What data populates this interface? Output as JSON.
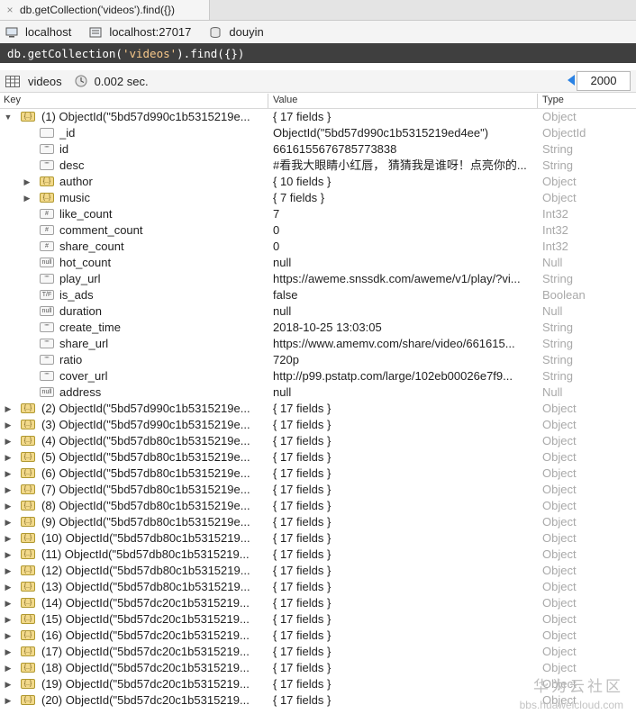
{
  "tab": {
    "title": "db.getCollection('videos').find({})",
    "close_glyph": "×"
  },
  "connection": {
    "host": "localhost",
    "port_label": "localhost:27017",
    "database": "douyin"
  },
  "query": {
    "prefix": "db.getCollection(",
    "collection_literal": "'videos'",
    "suffix": ").find({})"
  },
  "result": {
    "collection": "videos",
    "time": "0.002 sec.",
    "page_size": "2000"
  },
  "columns": {
    "key": "Key",
    "value": "Value",
    "type": "Type"
  },
  "rows": [
    {
      "key": "(1) ObjectId(\"5bd57d990c1b5315219e...",
      "value": "{ 17 fields }",
      "type": "Object",
      "level": 0,
      "tri": "▼",
      "icon": "obj"
    },
    {
      "key": "_id",
      "value": "ObjectId(\"5bd57d990c1b5315219ed4ee\")",
      "type": "ObjectId",
      "level": 1,
      "tri": "",
      "icon": "id"
    },
    {
      "key": "id",
      "value": "6616155676785773838",
      "type": "String",
      "level": 1,
      "tri": "",
      "icon": "str"
    },
    {
      "key": "desc",
      "value": "#看我大眼睛小红唇， 猜猜我是谁呀！点亮你的...",
      "type": "String",
      "level": 1,
      "tri": "",
      "icon": "str"
    },
    {
      "key": "author",
      "value": "{ 10 fields }",
      "type": "Object",
      "level": 1,
      "tri": "▶",
      "icon": "obj"
    },
    {
      "key": "music",
      "value": "{ 7 fields }",
      "type": "Object",
      "level": 1,
      "tri": "▶",
      "icon": "obj"
    },
    {
      "key": "like_count",
      "value": "7",
      "type": "Int32",
      "level": 1,
      "tri": "",
      "icon": "num"
    },
    {
      "key": "comment_count",
      "value": "0",
      "type": "Int32",
      "level": 1,
      "tri": "",
      "icon": "num"
    },
    {
      "key": "share_count",
      "value": "0",
      "type": "Int32",
      "level": 1,
      "tri": "",
      "icon": "num"
    },
    {
      "key": "hot_count",
      "value": "null",
      "type": "Null",
      "level": 1,
      "tri": "",
      "icon": "null"
    },
    {
      "key": "play_url",
      "value": "https://aweme.snssdk.com/aweme/v1/play/?vi...",
      "type": "String",
      "level": 1,
      "tri": "",
      "icon": "str"
    },
    {
      "key": "is_ads",
      "value": "false",
      "type": "Boolean",
      "level": 1,
      "tri": "",
      "icon": "bool"
    },
    {
      "key": "duration",
      "value": "null",
      "type": "Null",
      "level": 1,
      "tri": "",
      "icon": "null"
    },
    {
      "key": "create_time",
      "value": "2018-10-25 13:03:05",
      "type": "String",
      "level": 1,
      "tri": "",
      "icon": "str"
    },
    {
      "key": "share_url",
      "value": "https://www.amemv.com/share/video/661615...",
      "type": "String",
      "level": 1,
      "tri": "",
      "icon": "str"
    },
    {
      "key": "ratio",
      "value": "720p",
      "type": "String",
      "level": 1,
      "tri": "",
      "icon": "str"
    },
    {
      "key": "cover_url",
      "value": "http://p99.pstatp.com/large/102eb00026e7f9...",
      "type": "String",
      "level": 1,
      "tri": "",
      "icon": "str"
    },
    {
      "key": "address",
      "value": "null",
      "type": "Null",
      "level": 1,
      "tri": "",
      "icon": "null"
    },
    {
      "key": "(2) ObjectId(\"5bd57d990c1b5315219e...",
      "value": "{ 17 fields }",
      "type": "Object",
      "level": 0,
      "tri": "▶",
      "icon": "obj"
    },
    {
      "key": "(3) ObjectId(\"5bd57d990c1b5315219e...",
      "value": "{ 17 fields }",
      "type": "Object",
      "level": 0,
      "tri": "▶",
      "icon": "obj"
    },
    {
      "key": "(4) ObjectId(\"5bd57db80c1b5315219e...",
      "value": "{ 17 fields }",
      "type": "Object",
      "level": 0,
      "tri": "▶",
      "icon": "obj"
    },
    {
      "key": "(5) ObjectId(\"5bd57db80c1b5315219e...",
      "value": "{ 17 fields }",
      "type": "Object",
      "level": 0,
      "tri": "▶",
      "icon": "obj"
    },
    {
      "key": "(6) ObjectId(\"5bd57db80c1b5315219e...",
      "value": "{ 17 fields }",
      "type": "Object",
      "level": 0,
      "tri": "▶",
      "icon": "obj"
    },
    {
      "key": "(7) ObjectId(\"5bd57db80c1b5315219e...",
      "value": "{ 17 fields }",
      "type": "Object",
      "level": 0,
      "tri": "▶",
      "icon": "obj"
    },
    {
      "key": "(8) ObjectId(\"5bd57db80c1b5315219e...",
      "value": "{ 17 fields }",
      "type": "Object",
      "level": 0,
      "tri": "▶",
      "icon": "obj"
    },
    {
      "key": "(9) ObjectId(\"5bd57db80c1b5315219e...",
      "value": "{ 17 fields }",
      "type": "Object",
      "level": 0,
      "tri": "▶",
      "icon": "obj"
    },
    {
      "key": "(10) ObjectId(\"5bd57db80c1b5315219...",
      "value": "{ 17 fields }",
      "type": "Object",
      "level": 0,
      "tri": "▶",
      "icon": "obj"
    },
    {
      "key": "(11) ObjectId(\"5bd57db80c1b5315219...",
      "value": "{ 17 fields }",
      "type": "Object",
      "level": 0,
      "tri": "▶",
      "icon": "obj"
    },
    {
      "key": "(12) ObjectId(\"5bd57db80c1b5315219...",
      "value": "{ 17 fields }",
      "type": "Object",
      "level": 0,
      "tri": "▶",
      "icon": "obj"
    },
    {
      "key": "(13) ObjectId(\"5bd57db80c1b5315219...",
      "value": "{ 17 fields }",
      "type": "Object",
      "level": 0,
      "tri": "▶",
      "icon": "obj"
    },
    {
      "key": "(14) ObjectId(\"5bd57dc20c1b5315219...",
      "value": "{ 17 fields }",
      "type": "Object",
      "level": 0,
      "tri": "▶",
      "icon": "obj"
    },
    {
      "key": "(15) ObjectId(\"5bd57dc20c1b5315219...",
      "value": "{ 17 fields }",
      "type": "Object",
      "level": 0,
      "tri": "▶",
      "icon": "obj"
    },
    {
      "key": "(16) ObjectId(\"5bd57dc20c1b5315219...",
      "value": "{ 17 fields }",
      "type": "Object",
      "level": 0,
      "tri": "▶",
      "icon": "obj"
    },
    {
      "key": "(17) ObjectId(\"5bd57dc20c1b5315219...",
      "value": "{ 17 fields }",
      "type": "Object",
      "level": 0,
      "tri": "▶",
      "icon": "obj"
    },
    {
      "key": "(18) ObjectId(\"5bd57dc20c1b5315219...",
      "value": "{ 17 fields }",
      "type": "Object",
      "level": 0,
      "tri": "▶",
      "icon": "obj"
    },
    {
      "key": "(19) ObjectId(\"5bd57dc20c1b5315219...",
      "value": "{ 17 fields }",
      "type": "Object",
      "level": 0,
      "tri": "▶",
      "icon": "obj"
    },
    {
      "key": "(20) ObjectId(\"5bd57dc20c1b5315219...",
      "value": "{ 17 fields }",
      "type": "Object",
      "level": 0,
      "tri": "▶",
      "icon": "obj"
    }
  ],
  "icon_labels": {
    "obj": "{..}",
    "id": "",
    "str": "\"\"",
    "num": "#",
    "null": "null",
    "bool": "T/F"
  },
  "watermark": {
    "line1": "华为云社区",
    "line2": "bbs.huaweicloud.com"
  }
}
